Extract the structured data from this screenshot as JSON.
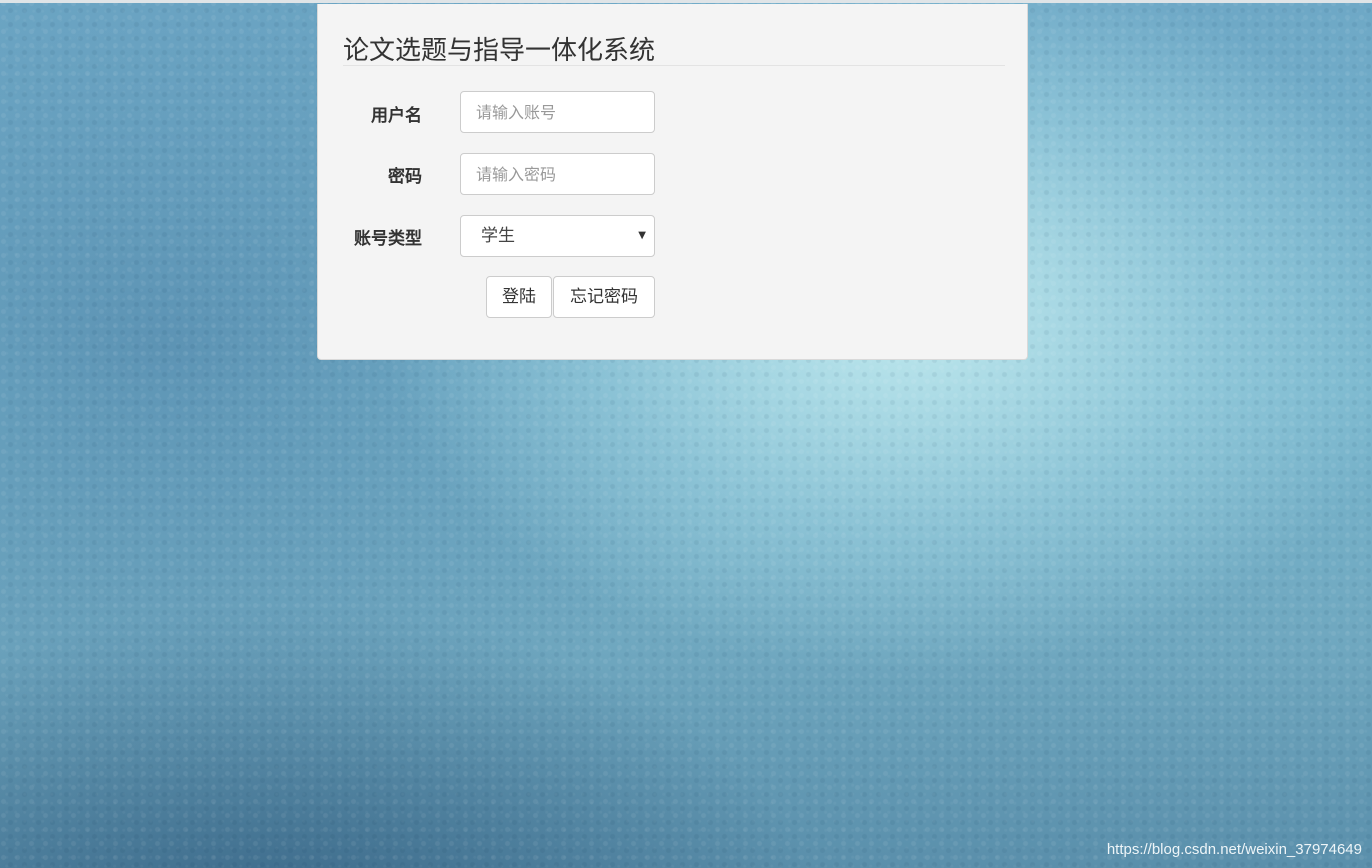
{
  "login_panel": {
    "title": "论文选题与指导一体化系统",
    "username": {
      "label": "用户名",
      "placeholder": "请输入账号",
      "value": ""
    },
    "password": {
      "label": "密码",
      "placeholder": "请输入密码",
      "value": ""
    },
    "account_type": {
      "label": "账号类型",
      "selected": "学生"
    },
    "login_button": "登陆",
    "forgot_button": "忘记密码"
  },
  "watermark": "https://blog.csdn.net/weixin_37974649",
  "icons": {
    "select_caret": "chevron-down-icon"
  },
  "colors": {
    "panel_bg": "#f4f4f4",
    "background_main": "#79b6cd"
  }
}
